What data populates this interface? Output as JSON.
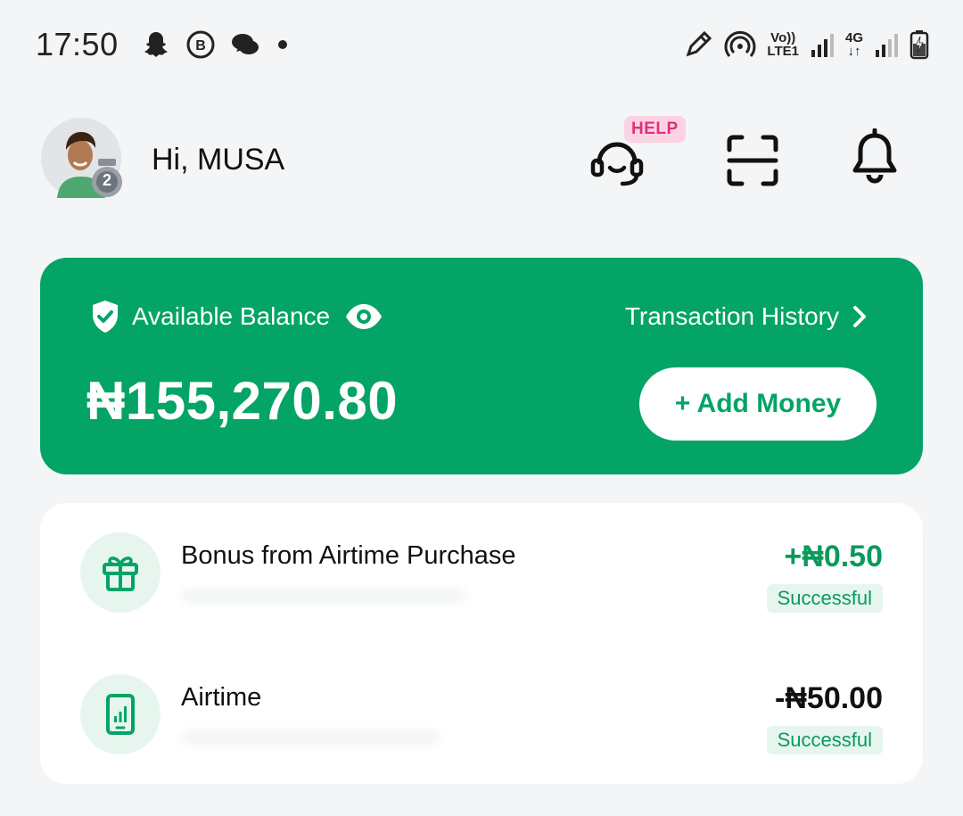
{
  "status_bar": {
    "time": "17:50",
    "net1_top": "Vo))",
    "net1_bottom": "LTE1",
    "net2_top": "4G",
    "net2_bottom": "↓↑"
  },
  "header": {
    "greeting": "Hi, MUSA",
    "avatar_level": "2",
    "help_badge": "HELP"
  },
  "balance": {
    "label": "Available Balance",
    "amount": "₦155,270.80",
    "history_link": "Transaction History",
    "add_money_label": "+ Add Money"
  },
  "transactions": [
    {
      "title": "Bonus from Airtime Purchase",
      "amount": "+₦0.50",
      "status": "Successful",
      "icon": "gift-icon",
      "amount_color": "#0a9a5c"
    },
    {
      "title": "Airtime",
      "amount": "-₦50.00",
      "status": "Successful",
      "icon": "phone-signal-icon",
      "amount_color": "#111111"
    }
  ],
  "colors": {
    "brand_green": "#03a466",
    "page_bg": "#f3f5f7",
    "help_pink": "#e0307a"
  }
}
